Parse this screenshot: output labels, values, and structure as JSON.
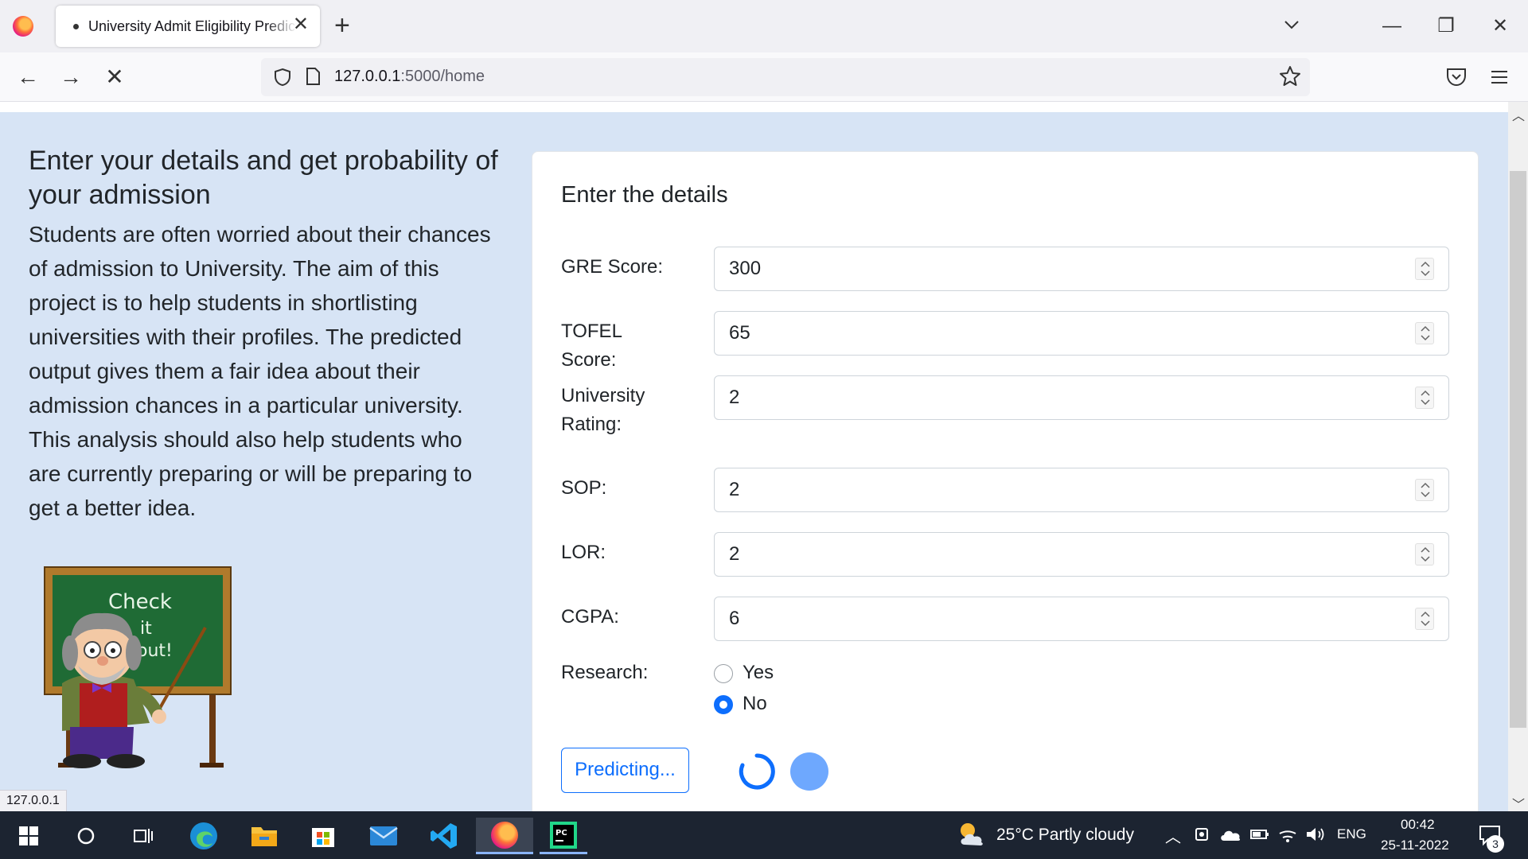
{
  "browser": {
    "tab_title": "University Admit Eligibility Predictor",
    "tab_close": "✕",
    "new_tab": "+",
    "url_host": "127.0.0.1",
    "url_path": ":5000/home",
    "status_tip": "127.0.0.1"
  },
  "window": {
    "minimize": "—",
    "restore": "❐",
    "close": "✕"
  },
  "left": {
    "heading": "Enter your details and get probability of your admission",
    "description": "Students are often worried about their chances of admission to University. The aim of this project is to help students in shortlisting universities with their profiles. The predicted output gives them a fair idea about their admission chances in a particular university. This analysis should also help students who are currently preparing or will be preparing to get a better idea.",
    "board_text": [
      "Check",
      "it",
      "out!"
    ]
  },
  "form": {
    "title": "Enter the details",
    "fields": [
      {
        "label": "GRE Score:",
        "value": "300"
      },
      {
        "label": "TOFEL Score:",
        "value": "65"
      },
      {
        "label": "University Rating:",
        "value": "2"
      },
      {
        "label": "SOP:",
        "value": "2"
      },
      {
        "label": "LOR:",
        "value": "2"
      },
      {
        "label": "CGPA:",
        "value": "6"
      }
    ],
    "research_label": "Research:",
    "research_options": [
      "Yes",
      "No"
    ],
    "research_selected": "No",
    "button_label": "Predicting..."
  },
  "taskbar": {
    "weather": "25°C  Partly cloudy",
    "language": "ENG",
    "time": "00:42",
    "date": "25-11-2022",
    "notification_count": "3"
  },
  "colors": {
    "accent": "#0d6efd",
    "page_bg": "#d7e4f5",
    "taskbar": "#1c2431"
  }
}
